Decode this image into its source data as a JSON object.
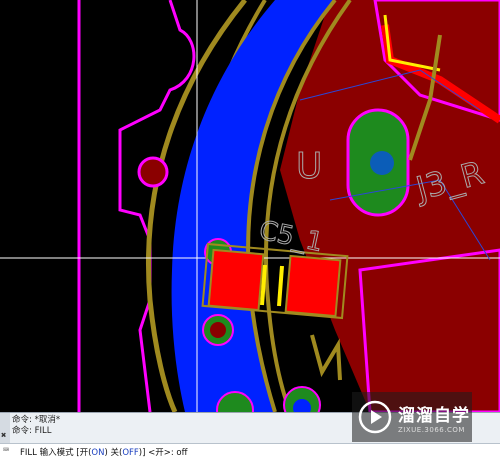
{
  "canvas": {
    "labels": {
      "u": "U",
      "j3": "J3_R",
      "c5": "C5_1"
    },
    "colors": {
      "background": "#000000",
      "outline": "#ff00ff",
      "trace": "#a08a1f",
      "copper_blue": "#0022ff",
      "copper_red": "#8b0000",
      "pad_red": "#ff0000",
      "pad_green": "#1e8a1e",
      "silk": "#ffee00",
      "crosshair": "#ffffff"
    }
  },
  "command_line": {
    "history": [
      "命令: *取消*",
      "命令: FILL"
    ],
    "prompt_prefix": "FILL 输入模式 [开(",
    "opt_on": "ON",
    "prompt_mid": ") 关(",
    "opt_off": "OFF",
    "prompt_suffix": ")] <开>: off"
  },
  "watermark": {
    "name": "溜溜自学",
    "url": "ZIXUE.3066.COM"
  }
}
